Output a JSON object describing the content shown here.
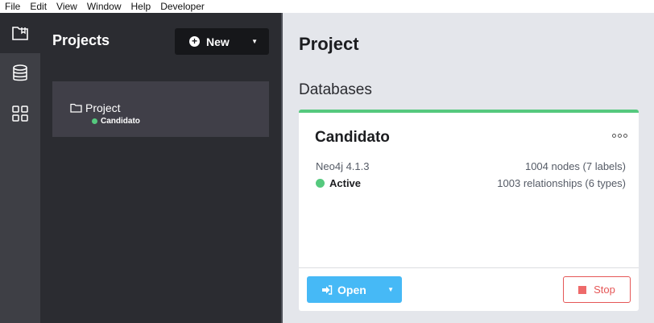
{
  "menubar": {
    "items": [
      "File",
      "Edit",
      "View",
      "Window",
      "Help",
      "Developer"
    ]
  },
  "rail": {
    "icons": [
      "projects-book-icon",
      "database-icon",
      "apps-grid-icon"
    ]
  },
  "projects_panel": {
    "title": "Projects",
    "new_button": {
      "label": "New"
    },
    "project": {
      "name": "Project",
      "database": "Candidato"
    }
  },
  "main": {
    "title": "Project",
    "databases_heading": "Databases",
    "db_card": {
      "name": "Candidato",
      "version": "Neo4j 4.1.3",
      "status": "Active",
      "nodes": "1004 nodes (7 labels)",
      "relationships": "1003 relationships (6 types)",
      "open_label": "Open",
      "stop_label": "Stop"
    }
  },
  "colors": {
    "accent_green": "#55c97e",
    "open_blue": "#46b9f6",
    "stop_red": "#e55757",
    "dark_panel": "#2b2c31"
  }
}
